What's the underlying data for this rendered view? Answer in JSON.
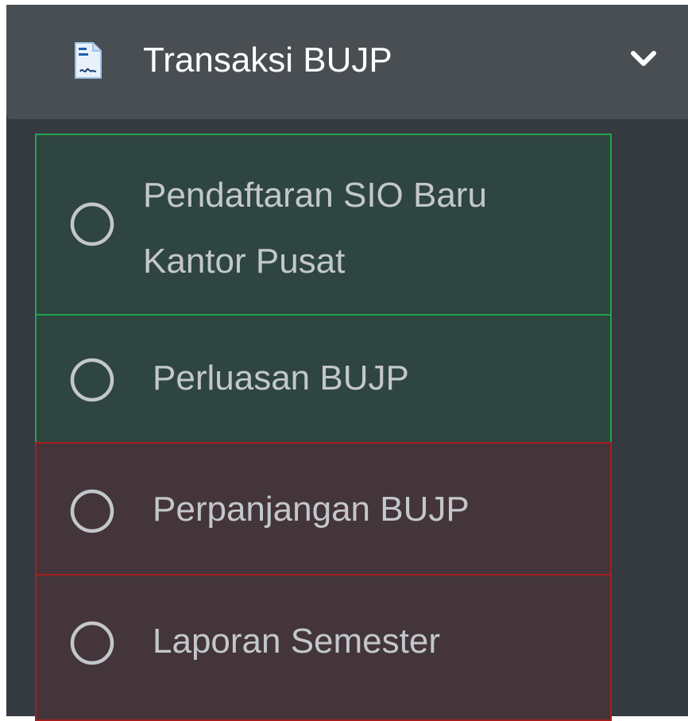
{
  "menu": {
    "title": "Transaksi BUJP",
    "icon": "file-signature-icon",
    "expand_icon": "chevron-down-icon",
    "items": [
      {
        "label": "Pendaftaran SIO Baru Kantor Pusat",
        "icon": "circle-outline-icon",
        "status": "green"
      },
      {
        "label": "Perluasan BUJP",
        "icon": "circle-outline-icon",
        "status": "green"
      },
      {
        "label": "Perpanjangan BUJP",
        "icon": "circle-outline-icon",
        "status": "red"
      },
      {
        "label": "Laporan Semester",
        "icon": "circle-outline-icon",
        "status": "red"
      }
    ]
  },
  "colors": {
    "sidebar_bg": "#343a40",
    "header_bg": "#494e53",
    "green_border": "#21a44d",
    "green_bg": "#2e4540",
    "red_border": "#a71d1d",
    "red_bg": "#433539",
    "text": "#c3c7cb"
  }
}
